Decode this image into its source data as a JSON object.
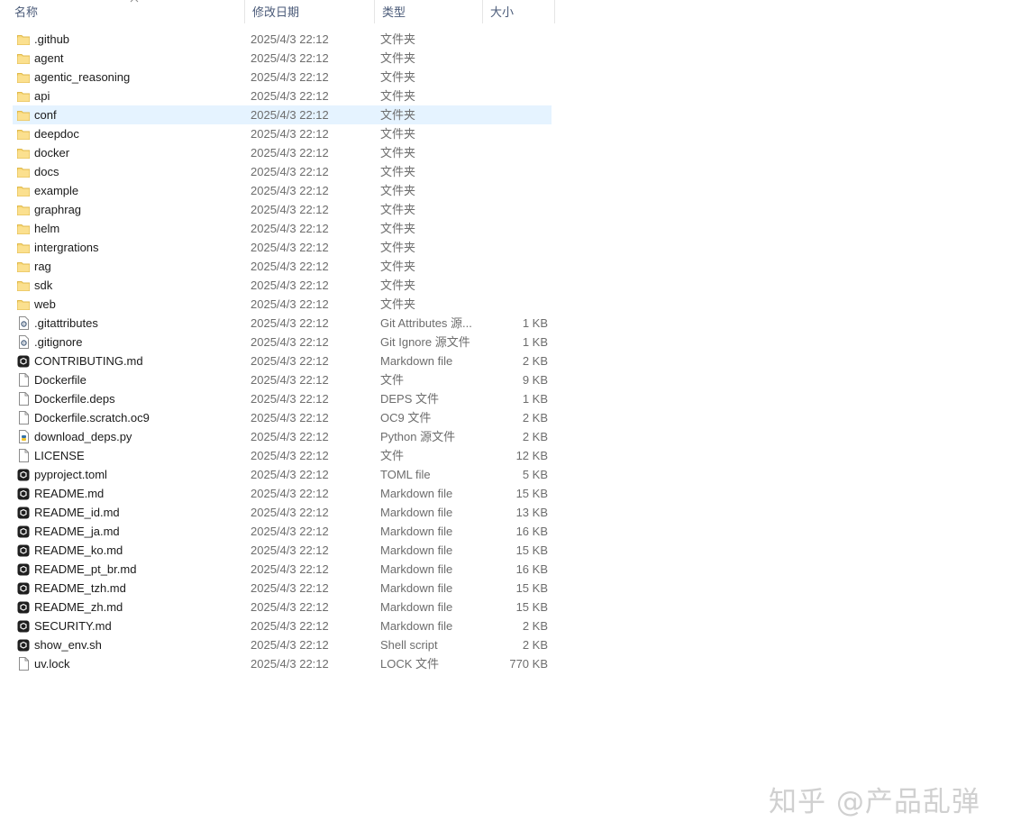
{
  "columns": {
    "name": "名称",
    "date": "修改日期",
    "type": "类型",
    "size": "大小"
  },
  "files": [
    {
      "name": ".github",
      "date": "2025/4/3 22:12",
      "type": "文件夹",
      "size": "",
      "icon": "folder-icon"
    },
    {
      "name": "agent",
      "date": "2025/4/3 22:12",
      "type": "文件夹",
      "size": "",
      "icon": "folder-icon"
    },
    {
      "name": "agentic_reasoning",
      "date": "2025/4/3 22:12",
      "type": "文件夹",
      "size": "",
      "icon": "folder-icon"
    },
    {
      "name": "api",
      "date": "2025/4/3 22:12",
      "type": "文件夹",
      "size": "",
      "icon": "folder-icon"
    },
    {
      "name": "conf",
      "date": "2025/4/3 22:12",
      "type": "文件夹",
      "size": "",
      "icon": "folder-icon",
      "selected": true
    },
    {
      "name": "deepdoc",
      "date": "2025/4/3 22:12",
      "type": "文件夹",
      "size": "",
      "icon": "folder-icon"
    },
    {
      "name": "docker",
      "date": "2025/4/3 22:12",
      "type": "文件夹",
      "size": "",
      "icon": "folder-icon"
    },
    {
      "name": "docs",
      "date": "2025/4/3 22:12",
      "type": "文件夹",
      "size": "",
      "icon": "folder-icon"
    },
    {
      "name": "example",
      "date": "2025/4/3 22:12",
      "type": "文件夹",
      "size": "",
      "icon": "folder-icon"
    },
    {
      "name": "graphrag",
      "date": "2025/4/3 22:12",
      "type": "文件夹",
      "size": "",
      "icon": "folder-icon"
    },
    {
      "name": "helm",
      "date": "2025/4/3 22:12",
      "type": "文件夹",
      "size": "",
      "icon": "folder-icon"
    },
    {
      "name": "intergrations",
      "date": "2025/4/3 22:12",
      "type": "文件夹",
      "size": "",
      "icon": "folder-icon"
    },
    {
      "name": "rag",
      "date": "2025/4/3 22:12",
      "type": "文件夹",
      "size": "",
      "icon": "folder-icon"
    },
    {
      "name": "sdk",
      "date": "2025/4/3 22:12",
      "type": "文件夹",
      "size": "",
      "icon": "folder-icon"
    },
    {
      "name": "web",
      "date": "2025/4/3 22:12",
      "type": "文件夹",
      "size": "",
      "icon": "folder-icon"
    },
    {
      "name": ".gitattributes",
      "date": "2025/4/3 22:12",
      "type": "Git Attributes 源...",
      "size": "1 KB",
      "icon": "gear-file-icon"
    },
    {
      "name": ".gitignore",
      "date": "2025/4/3 22:12",
      "type": "Git Ignore 源文件",
      "size": "1 KB",
      "icon": "gear-file-icon"
    },
    {
      "name": "CONTRIBUTING.md",
      "date": "2025/4/3 22:12",
      "type": "Markdown file",
      "size": "2 KB",
      "icon": "dark-app-icon"
    },
    {
      "name": "Dockerfile",
      "date": "2025/4/3 22:12",
      "type": "文件",
      "size": "9 KB",
      "icon": "blank-file-icon"
    },
    {
      "name": "Dockerfile.deps",
      "date": "2025/4/3 22:12",
      "type": "DEPS 文件",
      "size": "1 KB",
      "icon": "blank-file-icon"
    },
    {
      "name": "Dockerfile.scratch.oc9",
      "date": "2025/4/3 22:12",
      "type": "OC9 文件",
      "size": "2 KB",
      "icon": "blank-file-icon"
    },
    {
      "name": "download_deps.py",
      "date": "2025/4/3 22:12",
      "type": "Python 源文件",
      "size": "2 KB",
      "icon": "python-file-icon"
    },
    {
      "name": "LICENSE",
      "date": "2025/4/3 22:12",
      "type": "文件",
      "size": "12 KB",
      "icon": "blank-file-icon"
    },
    {
      "name": "pyproject.toml",
      "date": "2025/4/3 22:12",
      "type": "TOML file",
      "size": "5 KB",
      "icon": "dark-app-icon"
    },
    {
      "name": "README.md",
      "date": "2025/4/3 22:12",
      "type": "Markdown file",
      "size": "15 KB",
      "icon": "dark-app-icon"
    },
    {
      "name": "README_id.md",
      "date": "2025/4/3 22:12",
      "type": "Markdown file",
      "size": "13 KB",
      "icon": "dark-app-icon"
    },
    {
      "name": "README_ja.md",
      "date": "2025/4/3 22:12",
      "type": "Markdown file",
      "size": "16 KB",
      "icon": "dark-app-icon"
    },
    {
      "name": "README_ko.md",
      "date": "2025/4/3 22:12",
      "type": "Markdown file",
      "size": "15 KB",
      "icon": "dark-app-icon"
    },
    {
      "name": "README_pt_br.md",
      "date": "2025/4/3 22:12",
      "type": "Markdown file",
      "size": "16 KB",
      "icon": "dark-app-icon"
    },
    {
      "name": "README_tzh.md",
      "date": "2025/4/3 22:12",
      "type": "Markdown file",
      "size": "15 KB",
      "icon": "dark-app-icon"
    },
    {
      "name": "README_zh.md",
      "date": "2025/4/3 22:12",
      "type": "Markdown file",
      "size": "15 KB",
      "icon": "dark-app-icon"
    },
    {
      "name": "SECURITY.md",
      "date": "2025/4/3 22:12",
      "type": "Markdown file",
      "size": "2 KB",
      "icon": "dark-app-icon"
    },
    {
      "name": "show_env.sh",
      "date": "2025/4/3 22:12",
      "type": "Shell script",
      "size": "2 KB",
      "icon": "dark-app-icon"
    },
    {
      "name": "uv.lock",
      "date": "2025/4/3 22:12",
      "type": "LOCK 文件",
      "size": "770 KB",
      "icon": "blank-file-icon"
    }
  ],
  "watermark": "知乎 @产品乱弹",
  "colors": {
    "selection": "#e5f3ff",
    "folder": "#f8d775",
    "header_text": "#4a5a78"
  }
}
